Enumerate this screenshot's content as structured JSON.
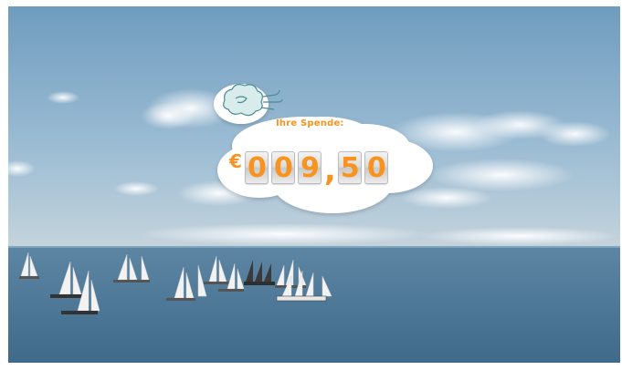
{
  "donation": {
    "label": "Ihre Spende:",
    "currency_symbol": "€",
    "digits": [
      "0",
      "0",
      "9",
      "5",
      "0"
    ],
    "separator": ",",
    "amount_display": "009,50"
  },
  "icons": {
    "wind": "wind-cloud-icon"
  },
  "colors": {
    "accent": "#f7931e",
    "sky_top": "#7fa8c8",
    "sea": "#4e7796"
  }
}
